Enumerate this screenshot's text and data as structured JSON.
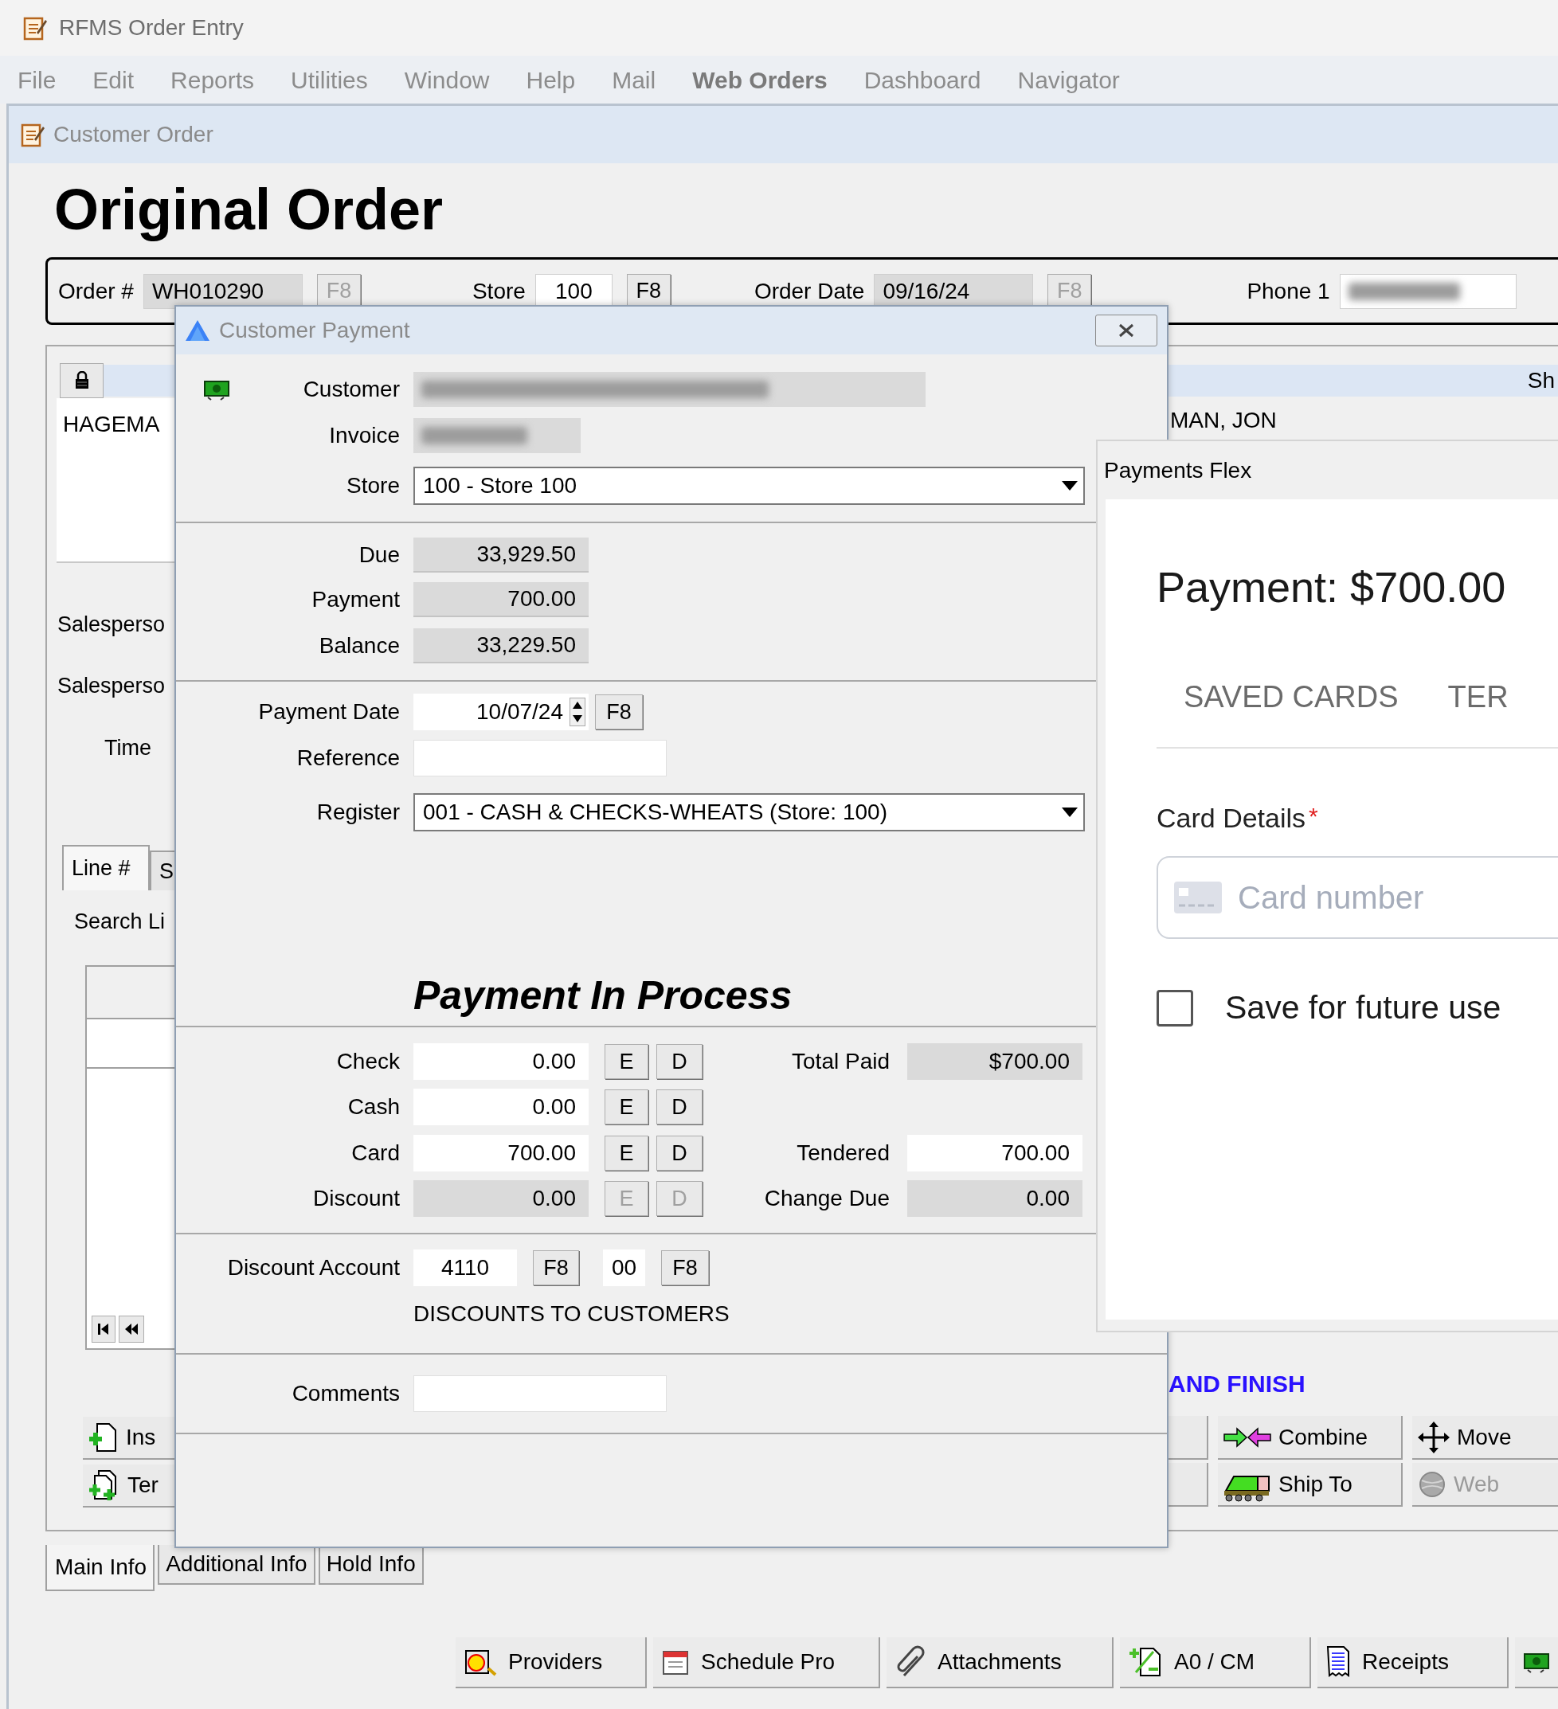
{
  "app": {
    "title": "RFMS Order Entry",
    "menu": [
      {
        "label": "File",
        "bold": false
      },
      {
        "label": "Edit",
        "bold": false
      },
      {
        "label": "Reports",
        "bold": false
      },
      {
        "label": "Utilities",
        "bold": false
      },
      {
        "label": "Window",
        "bold": false
      },
      {
        "label": "Help",
        "bold": false
      },
      {
        "label": "Mail",
        "bold": false
      },
      {
        "label": "Web Orders",
        "bold": true
      },
      {
        "label": "Dashboard",
        "bold": false
      },
      {
        "label": "Navigator",
        "bold": false
      }
    ]
  },
  "order_window": {
    "title": "Customer Order",
    "heading": "Original Order",
    "header_fields": [
      {
        "label": "Order #",
        "value": "WH010290",
        "readonly": true,
        "lookup": "F8",
        "lookup_disabled": true
      },
      {
        "label": "Store",
        "value": "100",
        "readonly": false,
        "lookup": "F8",
        "lookup_disabled": false
      },
      {
        "label": "Order Date",
        "value": "09/16/24",
        "readonly": true,
        "lookup": "F8",
        "lookup_disabled": true
      },
      {
        "label": "Phone 1",
        "redacted": true
      }
    ],
    "customer_header": "Sh",
    "customer_name_left": "HAGEMA",
    "customer_name_right": "MAN, JON",
    "left_labels": [
      "Salesperso",
      "Salesperso",
      "Time"
    ],
    "line_tabs": [
      {
        "label": "Line #",
        "selected": true
      },
      {
        "label": "S",
        "selected": false
      }
    ],
    "search_label": "Search Li",
    "status_message": "AND FINISH",
    "left_buttons": [
      {
        "label": "Ins"
      },
      {
        "label": "Ter"
      }
    ],
    "right_buttons": [
      {
        "label": "Combine",
        "disabled": false
      },
      {
        "label": "Move",
        "disabled": false
      },
      {
        "label": "Ship To",
        "disabled": false
      },
      {
        "label": "Web",
        "disabled": true
      }
    ],
    "tabs": [
      {
        "label": "Main Info",
        "selected": true
      },
      {
        "label": "Additional Info",
        "selected": false
      },
      {
        "label": "Hold Info",
        "selected": false
      }
    ],
    "toolbar": [
      {
        "label": "Providers"
      },
      {
        "label": "Schedule Pro"
      },
      {
        "label": "Attachments"
      },
      {
        "label": "A0 / CM"
      },
      {
        "label": "Receipts"
      }
    ]
  },
  "payment_dialog": {
    "title": "Customer Payment",
    "customer": {
      "label": "Customer",
      "redacted": true
    },
    "invoice": {
      "label": "Invoice",
      "redacted": true
    },
    "store": {
      "label": "Store",
      "value": "100 - Store 100"
    },
    "totals": [
      {
        "label": "Due",
        "value": "33,929.50"
      },
      {
        "label": "Payment",
        "value": "700.00"
      },
      {
        "label": "Balance",
        "value": "33,229.50"
      }
    ],
    "payment_date": {
      "label": "Payment Date",
      "value": "10/07/24",
      "lookup": "F8"
    },
    "reference": {
      "label": "Reference"
    },
    "register": {
      "label": "Register",
      "value": "001 - CASH & CHECKS-WHEATS (Store: 100)"
    },
    "section_title": "Payment In Process",
    "tenders": [
      {
        "label": "Check",
        "value": "0.00",
        "disabled": false,
        "buttons": [
          "E",
          "D"
        ],
        "side": {
          "label": "Total Paid",
          "value": "$700.00",
          "readonly": true
        }
      },
      {
        "label": "Cash",
        "value": "0.00",
        "disabled": false,
        "buttons": [
          "E",
          "D"
        ]
      },
      {
        "label": "Card",
        "value": "700.00",
        "disabled": false,
        "buttons": [
          "E",
          "D"
        ],
        "side": {
          "label": "Tendered",
          "value": "700.00",
          "readonly": false
        }
      },
      {
        "label": "Discount",
        "value": "0.00",
        "disabled": true,
        "buttons": [
          "E",
          "D"
        ],
        "side": {
          "label": "Change Due",
          "value": "0.00",
          "readonly": true
        }
      }
    ],
    "discount_account": {
      "label": "Discount Account",
      "account": "4110",
      "lookup": "F8",
      "sub_account": "00",
      "sub_lookup": "F8",
      "description": "DISCOUNTS TO CUSTOMERS"
    },
    "comments": {
      "label": "Comments"
    }
  },
  "payments_flex": {
    "title": "Payments Flex",
    "heading": "Payment: $700.00",
    "tabs": [
      {
        "label": "SAVED CARDS",
        "selected": false
      },
      {
        "label": "TER",
        "selected": false
      }
    ],
    "card_label": "Card Details",
    "required_mark": "*",
    "card_placeholder": "Card number",
    "save_option": {
      "label": "Save for future use",
      "checked": false
    }
  }
}
